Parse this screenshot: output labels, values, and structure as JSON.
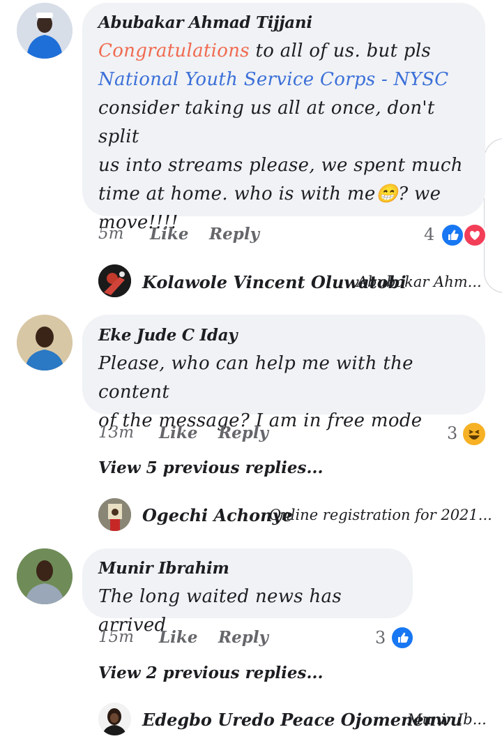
{
  "comments": [
    {
      "author": "Abubakar Ahmad Tijjani",
      "text_parts": {
        "highlight": "Congratulations",
        "after_highlight": " to all of us. but pls",
        "page_link": "National Youth Service Corps - NYSC",
        "rest_line1": "consider taking us all at once, don't split",
        "rest_line2": "us into streams please, we spent much",
        "rest_line3_a": "time at home. who is with me",
        "emoji": "😁",
        "rest_line3_b": "? we",
        "rest_line4": "move!!!!"
      },
      "time": "5m",
      "like": "Like",
      "reply": "Reply",
      "reaction_count": "4",
      "reactions": [
        "like-icon",
        "love-icon"
      ],
      "reply_preview": {
        "name": "Kolawole Vincent Oluwatobi",
        "snippet": "Abubakar Ahm..."
      }
    },
    {
      "author": "Eke Jude C Iday",
      "line1": "Please, who can help me with the content",
      "line2": "of the message? I am in free mode",
      "time": "13m",
      "like": "Like",
      "reply": "Reply",
      "reaction_count": "3",
      "reactions": [
        "haha-icon"
      ],
      "view_previous": "View 5 previous replies...",
      "reply_preview": {
        "name": "Ogechi Achonye",
        "snippet": "Online registration for 2021..."
      }
    },
    {
      "author": "Munir Ibrahim",
      "line1": "The long waited news has arrived",
      "time": "15m",
      "like": "Like",
      "reply": "Reply",
      "reaction_count": "3",
      "reactions": [
        "like-icon"
      ],
      "view_previous": "View 2 previous replies...",
      "reply_preview": {
        "name": "Edegbo Uredo Peace Ojomenenwu",
        "snippet": "Munir Ib..."
      }
    }
  ],
  "colors": {
    "bubble": "#f0f2f5",
    "meta": "#65676b",
    "like_blue": "#1877f2",
    "love_red": "#f33e58",
    "haha_yellow": "#f7b125",
    "highlight_orange": "#f06a50",
    "link_blue": "#3b6fd8"
  }
}
